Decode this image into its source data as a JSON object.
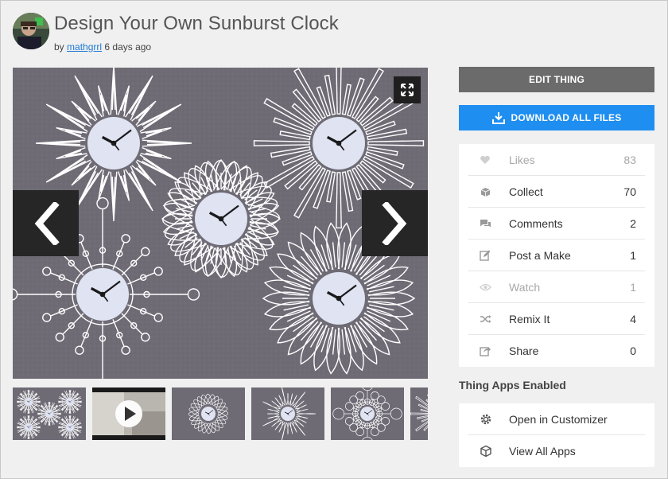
{
  "thing": {
    "title": "Design Your Own Sunburst Clock",
    "by_prefix": "by",
    "author": "mathgrrl",
    "posted": "6 days ago"
  },
  "gallery": {
    "prev_icon": "chevron-left-icon",
    "next_icon": "chevron-right-icon",
    "expand_icon": "expand-icon",
    "thumbnails": [
      {
        "name": "thumb-1",
        "type": "image"
      },
      {
        "name": "thumb-2",
        "type": "video"
      },
      {
        "name": "thumb-3",
        "type": "image"
      },
      {
        "name": "thumb-4",
        "type": "image"
      },
      {
        "name": "thumb-5",
        "type": "image"
      },
      {
        "name": "thumb-6",
        "type": "image"
      }
    ]
  },
  "actions": {
    "edit_label": "EDIT THING",
    "download_label": "DOWNLOAD ALL FILES"
  },
  "stats": [
    {
      "label": "Likes",
      "count": "83",
      "icon": "heart-icon",
      "muted": true
    },
    {
      "label": "Collect",
      "count": "70",
      "icon": "collect-icon",
      "muted": false
    },
    {
      "label": "Comments",
      "count": "2",
      "icon": "comment-icon",
      "muted": false
    },
    {
      "label": "Post a Make",
      "count": "1",
      "icon": "edit-icon",
      "muted": false
    },
    {
      "label": "Watch",
      "count": "1",
      "icon": "eye-icon",
      "muted": true
    },
    {
      "label": "Remix It",
      "count": "4",
      "icon": "shuffle-icon",
      "muted": false
    },
    {
      "label": "Share",
      "count": "0",
      "icon": "share-icon",
      "muted": false
    }
  ],
  "apps": {
    "title": "Thing Apps Enabled",
    "items": [
      {
        "label": "Open in Customizer",
        "icon": "gear-icon"
      },
      {
        "label": "View All Apps",
        "icon": "cube-icon"
      }
    ]
  },
  "colors": {
    "accent_blue": "#1e8ef0",
    "edit_gray": "#6b6b6b",
    "link": "#1e78d8"
  }
}
